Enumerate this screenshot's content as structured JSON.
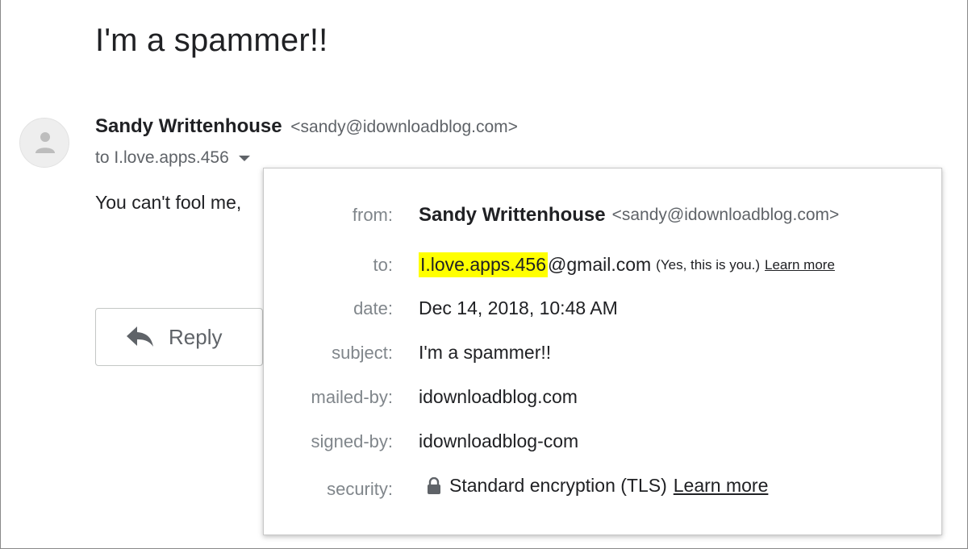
{
  "message": {
    "subject": "I'm a spammer!!",
    "sender_name": "Sandy Writtenhouse",
    "sender_email": "<sandy@idownloadblog.com>",
    "to_label": "to I.love.apps.456",
    "body_preview": "You can't fool me,"
  },
  "reply_button": {
    "label": "Reply"
  },
  "details": {
    "from_key": "from:",
    "from_name": "Sandy Writtenhouse",
    "from_email": "<sandy@idownloadblog.com>",
    "to_key": "to:",
    "to_highlight": "I.love.apps.456",
    "to_domain": "@gmail.com",
    "to_note": "(Yes, this is you.)",
    "to_learn_more": "Learn more",
    "date_key": "date:",
    "date_value": "Dec 14, 2018, 10:48 AM",
    "subject_key": "subject:",
    "subject_value": "I'm a spammer!!",
    "mailed_by_key": "mailed-by:",
    "mailed_by_value": "idownloadblog.com",
    "signed_by_key": "signed-by:",
    "signed_by_value": "idownloadblog-com",
    "security_key": "security:",
    "security_value": "Standard encryption (TLS)",
    "security_learn_more": "Learn more"
  },
  "icons": {
    "avatar": "person-icon",
    "caret": "chevron-down-icon",
    "reply": "reply-arrow-icon",
    "lock": "lock-icon"
  },
  "colors": {
    "highlight": "#ffff00",
    "secondary_text": "#5f6368",
    "label_text": "#80868b"
  }
}
